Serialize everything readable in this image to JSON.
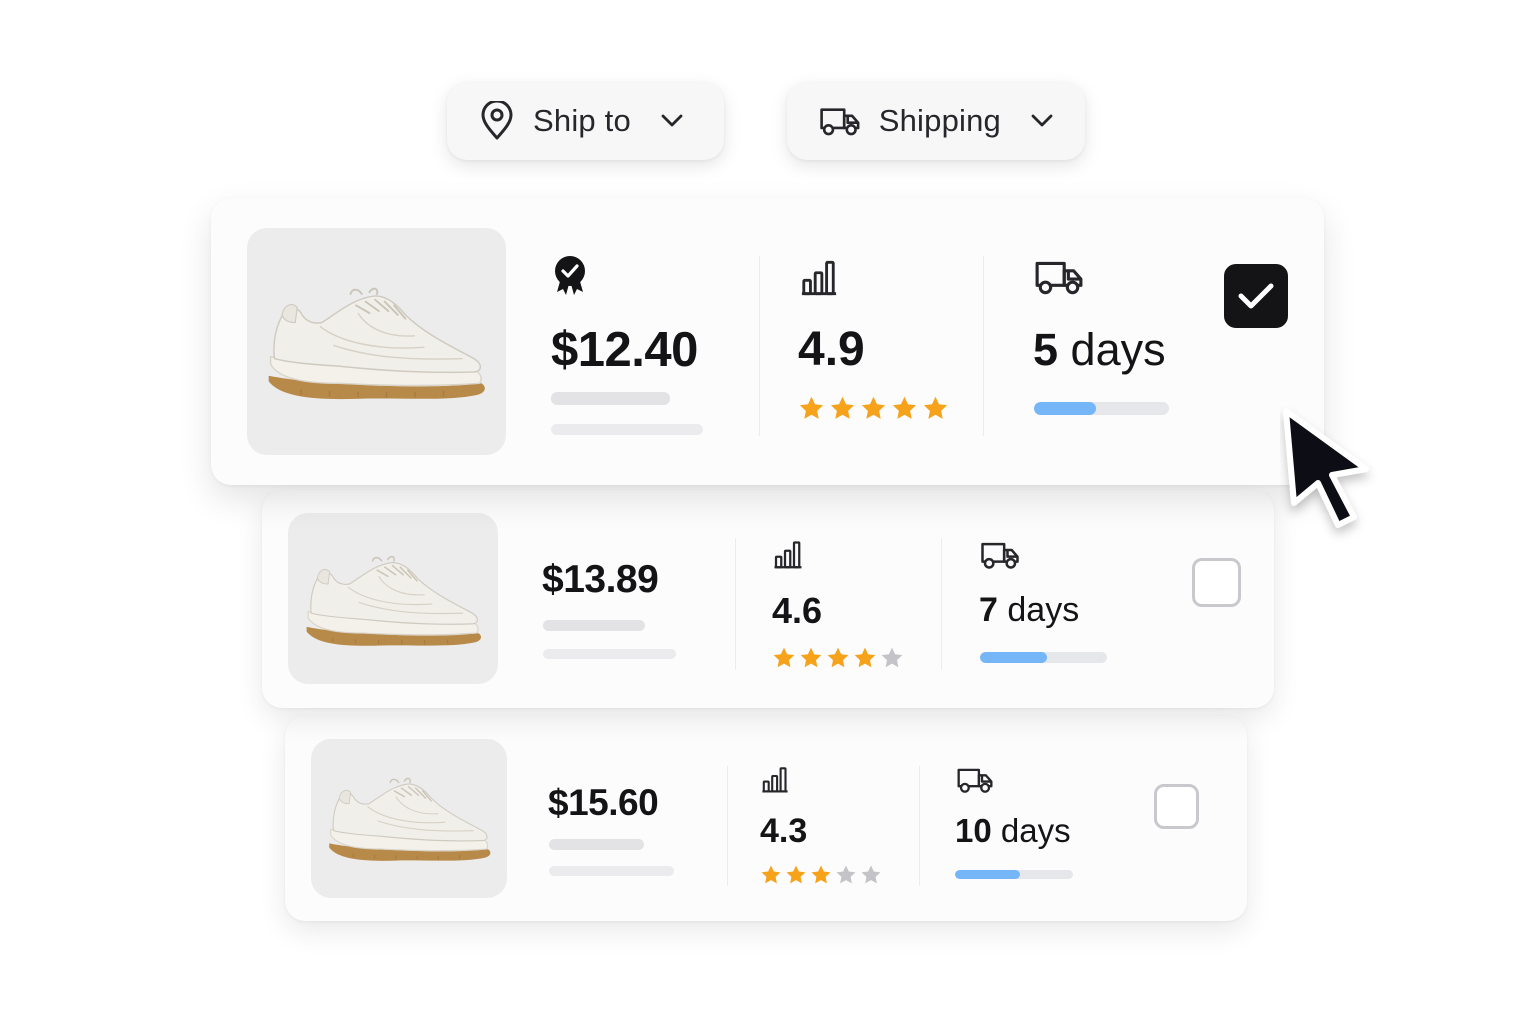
{
  "filters": {
    "ship_to": {
      "label": "Ship to",
      "icon": "location-pin-icon"
    },
    "shipping": {
      "label": "Shipping",
      "icon": "truck-icon"
    }
  },
  "offers": [
    {
      "price": "$12.40",
      "rating": "4.9",
      "stars": 5,
      "days_num": "5",
      "days_unit": "days",
      "delivery_progress": 0.46,
      "selected": true,
      "badge": "verified-badge-icon"
    },
    {
      "price": "$13.89",
      "rating": "4.6",
      "stars": 4,
      "days_num": "7",
      "days_unit": "days",
      "delivery_progress": 0.53,
      "selected": false
    },
    {
      "price": "$15.60",
      "rating": "4.3",
      "stars": 3,
      "days_num": "10",
      "days_unit": "days",
      "delivery_progress": 0.55,
      "selected": false
    }
  ],
  "colors": {
    "star_filled": "#f7a21b",
    "star_empty": "#c4c4c8",
    "progress": "#74b6f7",
    "checkbox_selected": "#141417"
  }
}
